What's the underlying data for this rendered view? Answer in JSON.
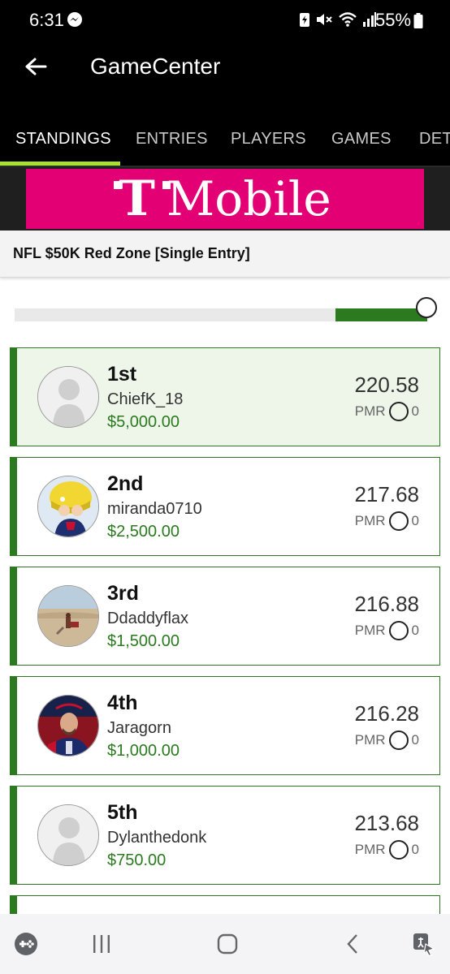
{
  "status_bar": {
    "time": "6:31",
    "battery_percent": "55%",
    "icons": [
      "messenger-icon",
      "battery-saver-icon",
      "mute-icon",
      "wifi-icon",
      "signal-icon",
      "battery-icon"
    ]
  },
  "app_bar": {
    "title": "GameCenter",
    "back_icon": "back-arrow-icon"
  },
  "tabs": [
    {
      "label": "STANDINGS",
      "active": true
    },
    {
      "label": "ENTRIES",
      "active": false
    },
    {
      "label": "PLAYERS",
      "active": false
    },
    {
      "label": "GAMES",
      "active": false
    },
    {
      "label": "DETA",
      "active": false
    }
  ],
  "banner": {
    "logo_letter": "T",
    "brand_word": "Mobile",
    "background_color": "#e20074"
  },
  "contest": {
    "name": "NFL $50K Red Zone [Single Entry]"
  },
  "slider": {
    "position_fraction": 0.97
  },
  "colors": {
    "accent_green": "#2b7a1f",
    "tab_indicator": "#a6e22e",
    "highlight_row": "#eef6ea"
  },
  "standings": [
    {
      "rank": "1st",
      "username": "ChiefK_18",
      "prize": "$5,000.00",
      "score": "220.58",
      "pmr_label": "PMR",
      "pmr_value": "0",
      "avatar": "default-avatar-icon",
      "highlighted": true
    },
    {
      "rank": "2nd",
      "username": "miranda0710",
      "prize": "$2,500.00",
      "score": "217.68",
      "pmr_label": "PMR",
      "pmr_value": "0",
      "avatar": "cartoon-avatar",
      "highlighted": false
    },
    {
      "rank": "3rd",
      "username": "Ddaddyflax",
      "prize": "$1,500.00",
      "score": "216.88",
      "pmr_label": "PMR",
      "pmr_value": "0",
      "avatar": "beach-photo-avatar",
      "highlighted": false
    },
    {
      "rank": "4th",
      "username": "Jaragorn",
      "prize": "$1,000.00",
      "score": "216.28",
      "pmr_label": "PMR",
      "pmr_value": "0",
      "avatar": "jersey-photo-avatar",
      "highlighted": false
    },
    {
      "rank": "5th",
      "username": "Dylanthedonk",
      "prize": "$750.00",
      "score": "213.68",
      "pmr_label": "PMR",
      "pmr_value": "0",
      "avatar": "default-avatar-icon",
      "highlighted": false
    }
  ],
  "nav_bar": {
    "buttons": [
      "game-launcher-icon",
      "recent-apps-icon",
      "home-icon",
      "back-icon",
      "accessibility-icon"
    ]
  }
}
